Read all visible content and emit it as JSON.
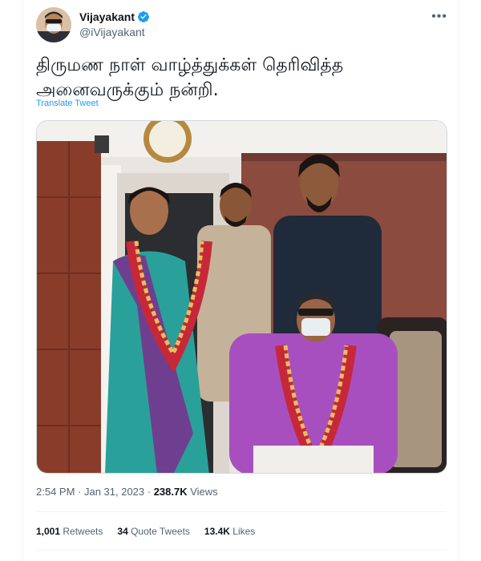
{
  "tweet": {
    "author": {
      "display_name": "Vijayakant",
      "handle": "@iVijayakant",
      "verified": true
    },
    "text": "திருமண நாள் வாழ்த்துக்கள் தெரிவித்த\nஅனைவருக்கும் நன்றி.",
    "translate_label": "Translate Tweet",
    "timestamp": "2:54 PM · Jan 31, 2023 · ",
    "views_count": "238.7K",
    "views_label": " Views",
    "stats": {
      "retweets_count": "1,001",
      "retweets_label": " Retweets",
      "quotes_count": "34",
      "quotes_label": " Quote Tweets",
      "likes_count": "13.4K",
      "likes_label": " Likes"
    },
    "more_icon": "more-horizontal-icon"
  },
  "colors": {
    "accent": "#1d9bf0",
    "text_primary": "#0f1419",
    "text_secondary": "#536471",
    "divider": "#eff3f4"
  }
}
